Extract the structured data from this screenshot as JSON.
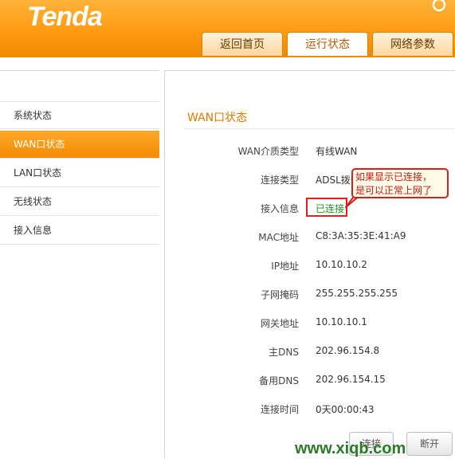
{
  "brand": {
    "logo_text": "Tenda"
  },
  "tabs": [
    {
      "label": "返回首页"
    },
    {
      "label": "运行状态"
    },
    {
      "label": "网络参数"
    }
  ],
  "sidebar": {
    "items": [
      {
        "label": "系统状态"
      },
      {
        "label": "WAN口状态"
      },
      {
        "label": "LAN口状态"
      },
      {
        "label": "无线状态"
      },
      {
        "label": "接入信息"
      }
    ]
  },
  "panel": {
    "title": "WAN口状态",
    "rows": [
      {
        "label": "WAN介质类型",
        "value": "有线WAN"
      },
      {
        "label": "连接类型",
        "value": "ADSL拨号"
      },
      {
        "label": "接入信息",
        "value": "已连接"
      },
      {
        "label": "MAC地址",
        "value": "C8:3A:35:3E:41:A9"
      },
      {
        "label": "IP地址",
        "value": "10.10.10.2"
      },
      {
        "label": "子网掩码",
        "value": "255.255.255.255"
      },
      {
        "label": "网关地址",
        "value": "10.10.10.1"
      },
      {
        "label": "主DNS",
        "value": "202.96.154.8"
      },
      {
        "label": "备用DNS",
        "value": "202.96.154.15"
      },
      {
        "label": "连接时间",
        "value": "0天00:00:43"
      }
    ],
    "buttons": {
      "connect": "连接",
      "disconnect": "断开"
    }
  },
  "annotation": {
    "line1": "如果显示已连接，",
    "line2": "是可以正常上网了"
  },
  "watermark": "www.xiqb.com",
  "colors": {
    "header_orange": "#ff9b12",
    "active_sidebar": "#f38b00",
    "title_orange": "#e07a00",
    "status_green": "#1a9a1a",
    "annotation_red": "#d62020"
  }
}
